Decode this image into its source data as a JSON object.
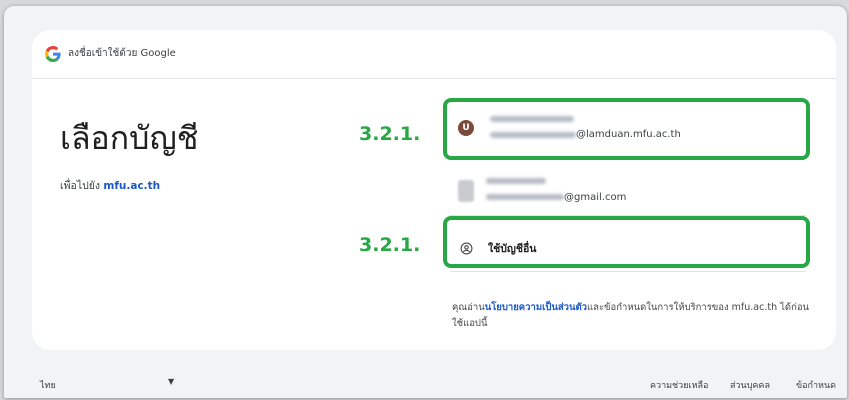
{
  "header": {
    "text": "ลงชื่อเข้าใช้ด้วย Google"
  },
  "main": {
    "title": "เลือกบัญชี",
    "subtitle_prefix": "เพื่อไปยัง",
    "subtitle_link": "mfu.ac.th"
  },
  "accounts": [
    {
      "avatar_letter": "U",
      "email_suffix": "@lamduan.mfu.ac.th"
    },
    {
      "email_suffix": "@gmail.com"
    }
  ],
  "other_account": {
    "label": "ใช้บัญชีอื่น",
    "icon": "account-circle-icon"
  },
  "privacy": {
    "prefix": "คุณอ่าน",
    "link": "นโยบายความเป็นส่วนตัว",
    "suffix": "และข้อกำหนดในการให้บริการของ mfu.ac.th ได้ก่อนใช้แอปนี้"
  },
  "annotations": {
    "step_label_1": "3.2.1.",
    "step_label_2": "3.2.1.",
    "highlight_color": "#28a745"
  },
  "footer": {
    "language": "ไทย",
    "help": "ความช่วยเหลือ",
    "privacy": "ส่วนบุคคล",
    "terms": "ข้อกำหนด"
  },
  "colors": {
    "link": "#1a57c9",
    "avatar": "#7b4a3c"
  }
}
